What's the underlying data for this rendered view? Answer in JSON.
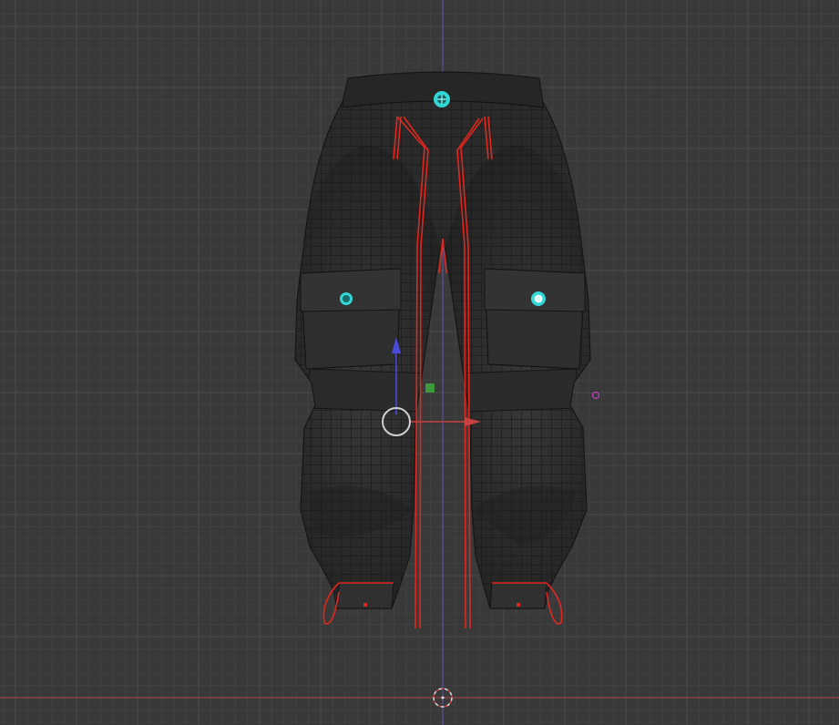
{
  "viewport": {
    "view": "front-orthographic",
    "background_color": "#393939",
    "grid_minor_color": "#414141",
    "grid_major_color": "#4a4a4a",
    "x_axis_color": "#b04545",
    "z_axis_color": "#5b5bb5",
    "grid_visible": true
  },
  "object": {
    "name": "",
    "type": "cargo-pants mesh (wireframe overlay)",
    "base_color": "#2a2a2a",
    "wire_color": "#111111",
    "seam_color": "#e0271d",
    "selected": true
  },
  "gizmo": {
    "type": "translate",
    "x_arrow_color": "#c94040",
    "z_arrow_color": "#4a4adb",
    "center_circle_color": "#d0d0d0",
    "plane_handle_color": "#3c9a3c"
  },
  "markers": {
    "empty_color": "#31d6d6",
    "light_color": "#c040c0",
    "cursor_color": "#dddddd"
  }
}
